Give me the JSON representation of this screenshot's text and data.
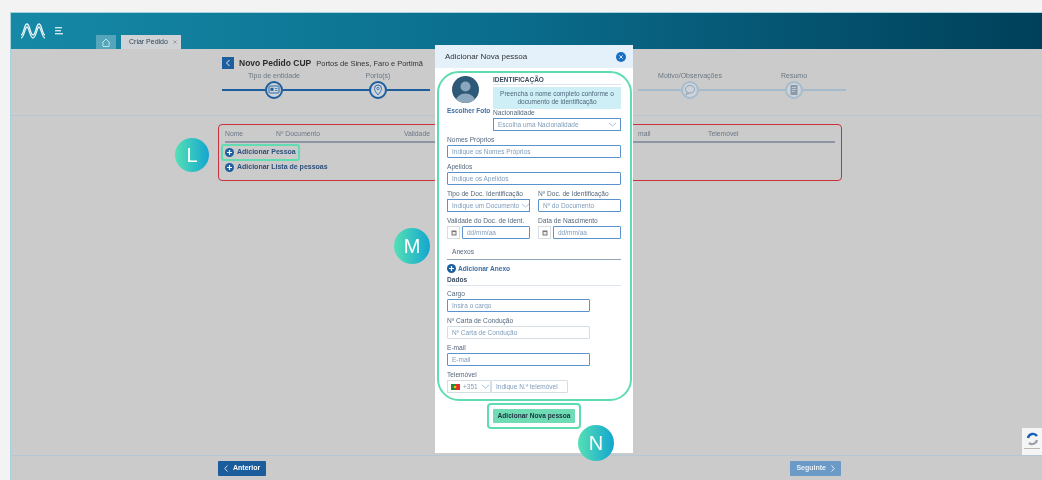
{
  "header": {
    "tabs": [
      {
        "kind": "home",
        "selected": false
      },
      {
        "kind": "page",
        "label": "Criar Pedido",
        "selected": true
      }
    ]
  },
  "page": {
    "title": "Novo Pedido CUP",
    "subtitle": "Portos de Sines, Faro e Portimã",
    "steps": [
      {
        "label": "Tipo de entidade",
        "active": true
      },
      {
        "label": "Porto(s)",
        "active": true
      },
      {
        "label": "Motivo/Observações",
        "active": false
      },
      {
        "label": "Resumo",
        "active": false
      }
    ],
    "table": {
      "columns": [
        "Nome",
        "Nº Documento",
        "Validade",
        "mail",
        "Telemóvel"
      ],
      "actions": [
        "Adicionar Pessoa",
        "Adicionar Lista de pessoas"
      ]
    },
    "buttons": [
      {
        "label": "Anterior",
        "disabled": false
      },
      {
        "label": "Seguinte",
        "disabled": true
      }
    ]
  },
  "modal": {
    "title": "Adicionar Nova pessoa",
    "photo_label": "Escolher Foto",
    "section": "IDENTIFICAÇÃO",
    "notice": "Preencha o nome completo conforme o documento de identificação",
    "nationality": {
      "label": "Nacionalidade",
      "kind": "select",
      "placeholder": "Escolha uma Nacionalidade",
      "highlighted": true
    },
    "identity_rows": [
      [
        {
          "label": "Nomes Próprios",
          "kind": "text",
          "placeholder": "Indique os Nomes Próprios",
          "highlighted": true
        }
      ],
      [
        {
          "label": "Apelidos",
          "kind": "text",
          "placeholder": "Indique os Apelidos",
          "highlighted": true
        }
      ],
      [
        {
          "label": "Tipo de Doc. Identificação",
          "kind": "select",
          "placeholder": "Indique um Documento",
          "highlighted": true
        },
        {
          "label": "Nº Doc. de Identificação",
          "kind": "text",
          "placeholder": "Nº do Documento",
          "highlighted": true
        }
      ],
      [
        {
          "label": "Validade do Doc. de Ident.",
          "kind": "date",
          "placeholder": "dd/mm/aa",
          "highlighted": true
        },
        {
          "label": "Data de Nascimento",
          "kind": "date",
          "placeholder": "dd/mm/aa",
          "highlighted": true
        }
      ]
    ],
    "attachments_tab": "Anexos",
    "add_attachment": "Adicionar Anexo",
    "data_heading": "Dados",
    "data_fields": [
      {
        "label": "Cargo",
        "kind": "text",
        "placeholder": "Insira o cargo",
        "highlighted": true
      },
      {
        "label": "Nº Carta de Condução",
        "kind": "text",
        "placeholder": "Nº Carta de Condução",
        "highlighted": false
      },
      {
        "label": "E-mail",
        "kind": "text",
        "placeholder": "E-mail",
        "highlighted": true
      },
      {
        "label": "Telemóvel",
        "kind": "phone",
        "prefix": "+351",
        "placeholder": "Indique N.º telemóvel",
        "highlighted": false
      }
    ],
    "submit": "Adicionar Nova pessoa"
  },
  "annotations": [
    {
      "label": "L"
    },
    {
      "label": "M"
    },
    {
      "label": "N"
    }
  ]
}
